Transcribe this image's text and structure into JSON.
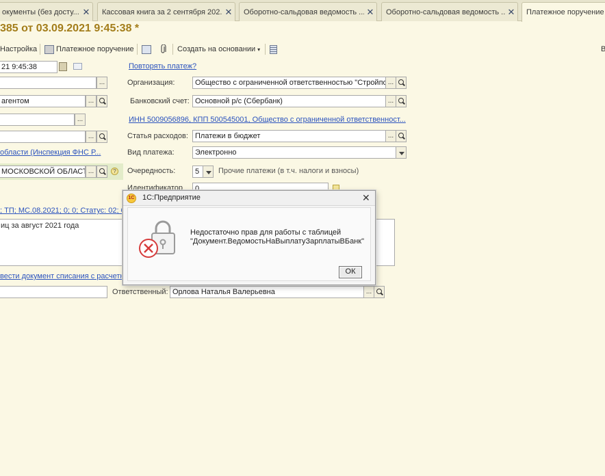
{
  "tabs": [
    {
      "label": "окументы (без досту...",
      "close": "✕"
    },
    {
      "label": "Кассовая книга за 2 сентября 202...",
      "close": "✕"
    },
    {
      "label": "Оборотно-сальдовая ведомость ...",
      "close": "✕"
    },
    {
      "label": "Оборотно-сальдовая ведомость ...",
      "close": "✕"
    },
    {
      "label": "Платежное поручение",
      "close": ""
    }
  ],
  "document": {
    "title": "385 от 03.09.2021 9:45:38 *"
  },
  "toolbar": {
    "settings": "Настройка",
    "payment_order": "Платежное поручение",
    "create_based_on": "Создать на основании",
    "right_edge": "В"
  },
  "form": {
    "date_value": "21  9:45:38",
    "repeat_payment_link": "Повторять платеж?",
    "organization_label": "Организация:",
    "organization_value": "Общество с ограниченной ответственностью \"Стройпос",
    "bank_account_label": "Банковский счет:",
    "bank_account_value": "Основной р/с (Сбербанк)",
    "agent_value": "агентом",
    "inn_link": "ИНН 5009056896, КПП 500545001, Общество с ограниченной ответственност...",
    "expense_item_label": "Статья расходов:",
    "expense_item_value": "Платежи в бюджет",
    "tax_office_link": "области (Инспекция ФНС Р...",
    "payment_type_label": "Вид платежа:",
    "payment_type_value": "Электронно",
    "recipient_value": "МОСКОВСКОЙ ОБЛАСТИ",
    "help_icon": "?",
    "priority_label": "Очередность:",
    "priority_value": "5",
    "priority_note": "Прочие платежи (в т.ч. налоги и взносы)",
    "identifier_label": "Идентификатор",
    "identifier_value": "0",
    "status_link": "; ТП; МС.08.2021; 0; 0; Статус: 02; 0",
    "purpose_text": "иц за август 2021 года",
    "writeoff_link": "вести документ списания с расчетн",
    "responsible_label": "Ответственный:",
    "responsible_value": "Орлова Наталья Валерьевна",
    "ellipsis": "...",
    "dd_button": "..."
  },
  "dialog": {
    "title": "1С:Предприятие",
    "logo": "1С",
    "close": "✕",
    "message_line1": "Недостаточно прав для работы с таблицей",
    "message_line2": "\"Документ.ВедомостьНаВыплатуЗарплатыВБанк\"",
    "ok_label": "ОК"
  }
}
